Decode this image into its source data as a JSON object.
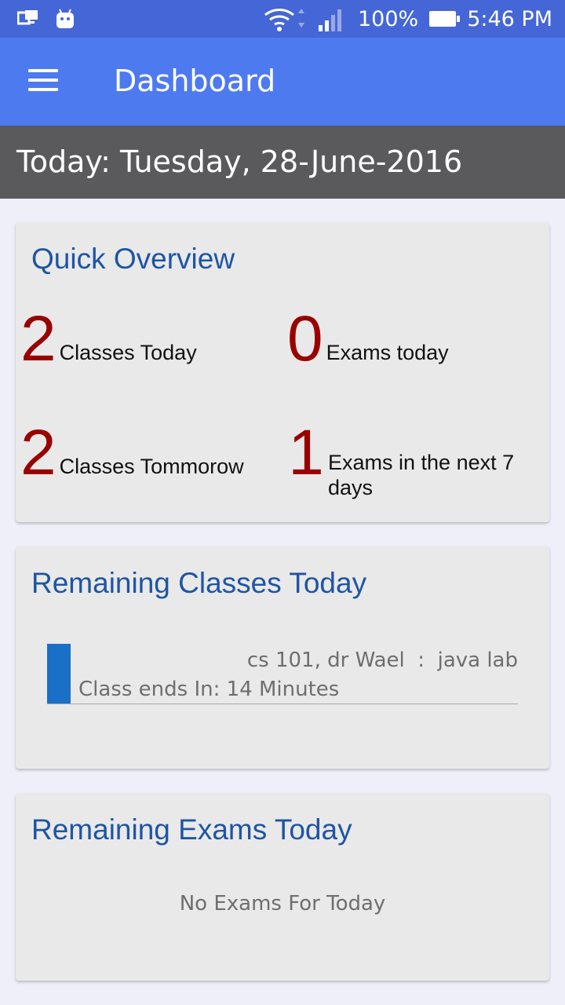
{
  "status_bar": {
    "left_icons": [
      "screen-mirror-icon",
      "android-icon"
    ],
    "wifi_icon": "wifi-icon",
    "signal_icon": "signal-icon",
    "battery": "100%",
    "time": "5:46 PM"
  },
  "toolbar": {
    "menu_icon": "menu-icon",
    "title": "Dashboard"
  },
  "date_bar": {
    "text": "Today: Tuesday, 28-June-2016"
  },
  "overview": {
    "title": "Quick Overview",
    "stats": [
      {
        "value": "2",
        "label": "Classes Today"
      },
      {
        "value": "0",
        "label": "Exams today"
      },
      {
        "value": "2",
        "label": "Classes Tommorow"
      },
      {
        "value": "1",
        "label": "Exams in the next 7 days"
      }
    ]
  },
  "remaining_classes": {
    "title": "Remaining Classes Today",
    "items": [
      {
        "name": "cs 101, dr Wael  :  java lab",
        "ends": "Class ends In: 14 Minutes"
      }
    ]
  },
  "remaining_exams": {
    "title": "Remaining Exams Today",
    "empty": "No Exams For Today"
  },
  "colors": {
    "status_bar": "#4566d6",
    "toolbar": "#4e7af0",
    "date_bar": "#5a5a5c",
    "card_title": "#1e55a3",
    "stat_number": "#990000",
    "class_indicator": "#1a6fc6"
  }
}
